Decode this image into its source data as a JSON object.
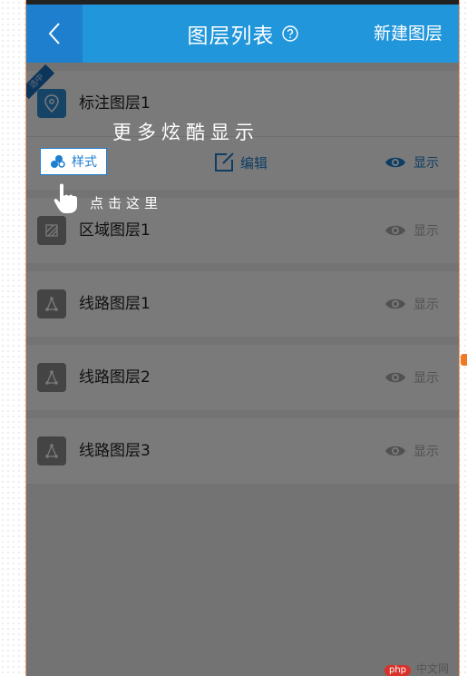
{
  "header": {
    "title": "图层列表",
    "new_layer_label": "新建图层"
  },
  "layers": [
    {
      "name": "标注图层1",
      "icon": "location-pin-icon",
      "selected_label": "选中"
    },
    {
      "name": "区域图层1",
      "icon": "area-icon"
    },
    {
      "name": "线路图层1",
      "icon": "route-icon"
    },
    {
      "name": "线路图层2",
      "icon": "route-icon"
    },
    {
      "name": "线路图层3",
      "icon": "route-icon"
    }
  ],
  "actions": {
    "style_label": "样式",
    "edit_label": "编辑",
    "show_label": "显示"
  },
  "hints": {
    "more_cool": "更多炫酷显示",
    "click_here": "点击这里"
  },
  "watermark": {
    "logo": "php",
    "text": "中文网"
  },
  "colors": {
    "header": "#2196db",
    "back_button": "#1f7fcf",
    "accent": "#1e7fd0",
    "side_tab": "#f07a23"
  }
}
